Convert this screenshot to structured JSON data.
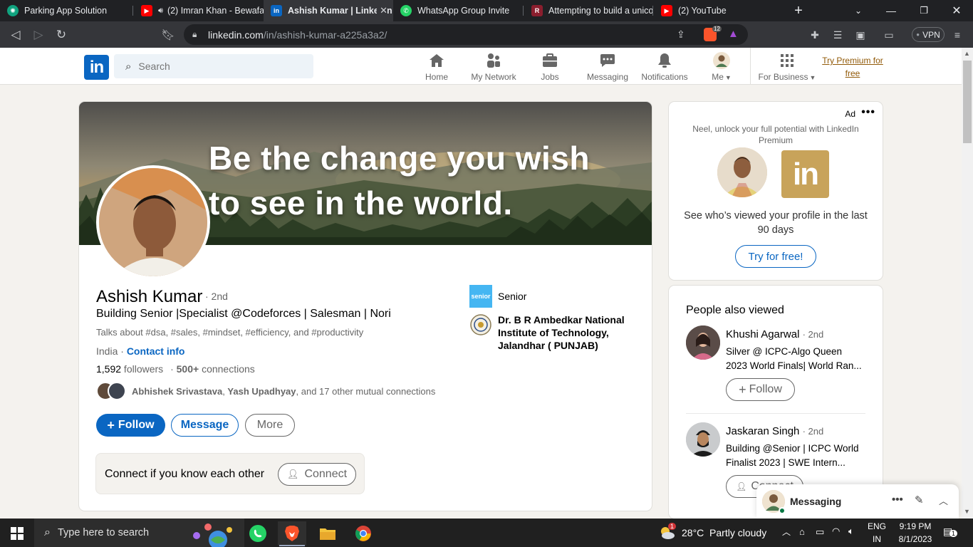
{
  "browser": {
    "tabs": [
      {
        "title": "Parking App Solution",
        "icon": "chatgpt-icon"
      },
      {
        "title": "(2) Imran Khan - Bewafa",
        "icon": "youtube-icon"
      },
      {
        "title": "Ashish Kumar | LinkedIn",
        "icon": "linkedin-icon",
        "active": true
      },
      {
        "title": "WhatsApp Group Invite",
        "icon": "whatsapp-icon"
      },
      {
        "title": "Attempting to build a unico",
        "icon": "page-icon"
      },
      {
        "title": "(2) YouTube",
        "icon": "youtube-icon"
      }
    ],
    "url_domain": "linkedin.com",
    "url_path": "/in/ashish-kumar-a225a3a2/",
    "brave_badge": "12",
    "vpn_label": "VPN"
  },
  "header": {
    "logo": "in",
    "search_placeholder": "Search",
    "nav": {
      "home": "Home",
      "network": "My Network",
      "jobs": "Jobs",
      "messaging": "Messaging",
      "notifications": "Notifications",
      "me": "Me",
      "business": "For Business"
    },
    "premium_line1": "Try Premium for",
    "premium_line2": "free"
  },
  "profile": {
    "banner_line1": "Be the change you wish",
    "banner_line2": "to see in the world.",
    "name": "Ashish Kumar",
    "degree": "· 2nd",
    "headline": "Building Senior |Specialist @Codeforces | Salesman | Nori",
    "talks_about": "Talks about #dsa, #sales, #mindset, #efficiency, and #productivity",
    "location": "India",
    "location_sep": " · ",
    "contact_info": "Contact info",
    "followers_count": "1,592",
    "followers_label": " followers",
    "connections_sep": "· ",
    "connections_count": "500+",
    "connections_label": " connections",
    "mutual_name1": "Abhishek Srivastava",
    "mutual_sep": ", ",
    "mutual_name2": "Yash Upadhyay",
    "mutual_rest": ", and 17 other mutual connections",
    "follow_label": "Follow",
    "message_label": "Message",
    "more_label": "More",
    "connect_prompt": "Connect if you know each other",
    "connect_label": "Connect",
    "orgs": [
      {
        "logo_text": "senior",
        "name": "Senior"
      },
      {
        "name": "Dr. B R Ambedkar National Institute of Technology, Jalandhar ( PUNJAB)"
      }
    ]
  },
  "ad": {
    "label": "Ad",
    "line1": "Neel, unlock your full potential with LinkedIn Premium",
    "logo": "in",
    "line2": "See who’s viewed your profile in the last 90 days",
    "cta": "Try for free!"
  },
  "people_also_viewed": {
    "title": "People also viewed",
    "items": [
      {
        "name": "Khushi Agarwal",
        "degree": "· 2nd",
        "headline": "Silver @ ICPC-Algo Queen 2023 World Finals| World Ran...",
        "action": "Follow"
      },
      {
        "name": "Jaskaran Singh",
        "degree": "· 2nd",
        "headline": "Building @Senior | ICPC World Finalist 2023 | SWE Intern...",
        "action": "Connect"
      }
    ]
  },
  "messaging_widget": {
    "title": "Messaging"
  },
  "taskbar": {
    "search_placeholder": "Type here to search",
    "weather_badge": "1",
    "weather": "28°C  Partly cloudy",
    "lang1": "ENG",
    "lang2": "IN",
    "time": "9:19 PM",
    "date": "8/1/2023",
    "notif_count": "1"
  }
}
